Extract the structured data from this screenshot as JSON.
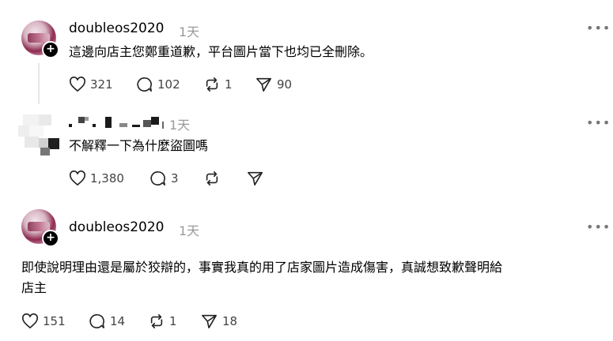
{
  "posts": [
    {
      "username": "doubleos2020",
      "time": "1天",
      "text": "這邊向店主您鄭重道歉，平台圖片當下也均已全刪除。",
      "likes": "321",
      "comments": "102",
      "reposts": "1",
      "shares": "90"
    },
    {
      "username": "",
      "time": "1天",
      "text": "不解釋一下為什麼盜圖嗎",
      "likes": "1,380",
      "comments": "3",
      "reposts": "",
      "shares": ""
    },
    {
      "username": "doubleos2020",
      "time": "1天",
      "text_line1": "即使說明理由還是屬於狡辯的，事實我真的用了店家圖片造成傷害，真誠想致歉聲明給",
      "text_line2": "店主",
      "likes": "151",
      "comments": "14",
      "reposts": "1",
      "shares": "18"
    }
  ],
  "icons": {
    "more": "more-horizontal-icon",
    "like": "heart-icon",
    "comment": "comment-bubble-icon",
    "repost": "repost-icon",
    "share": "send-icon"
  },
  "more_label": "•••"
}
